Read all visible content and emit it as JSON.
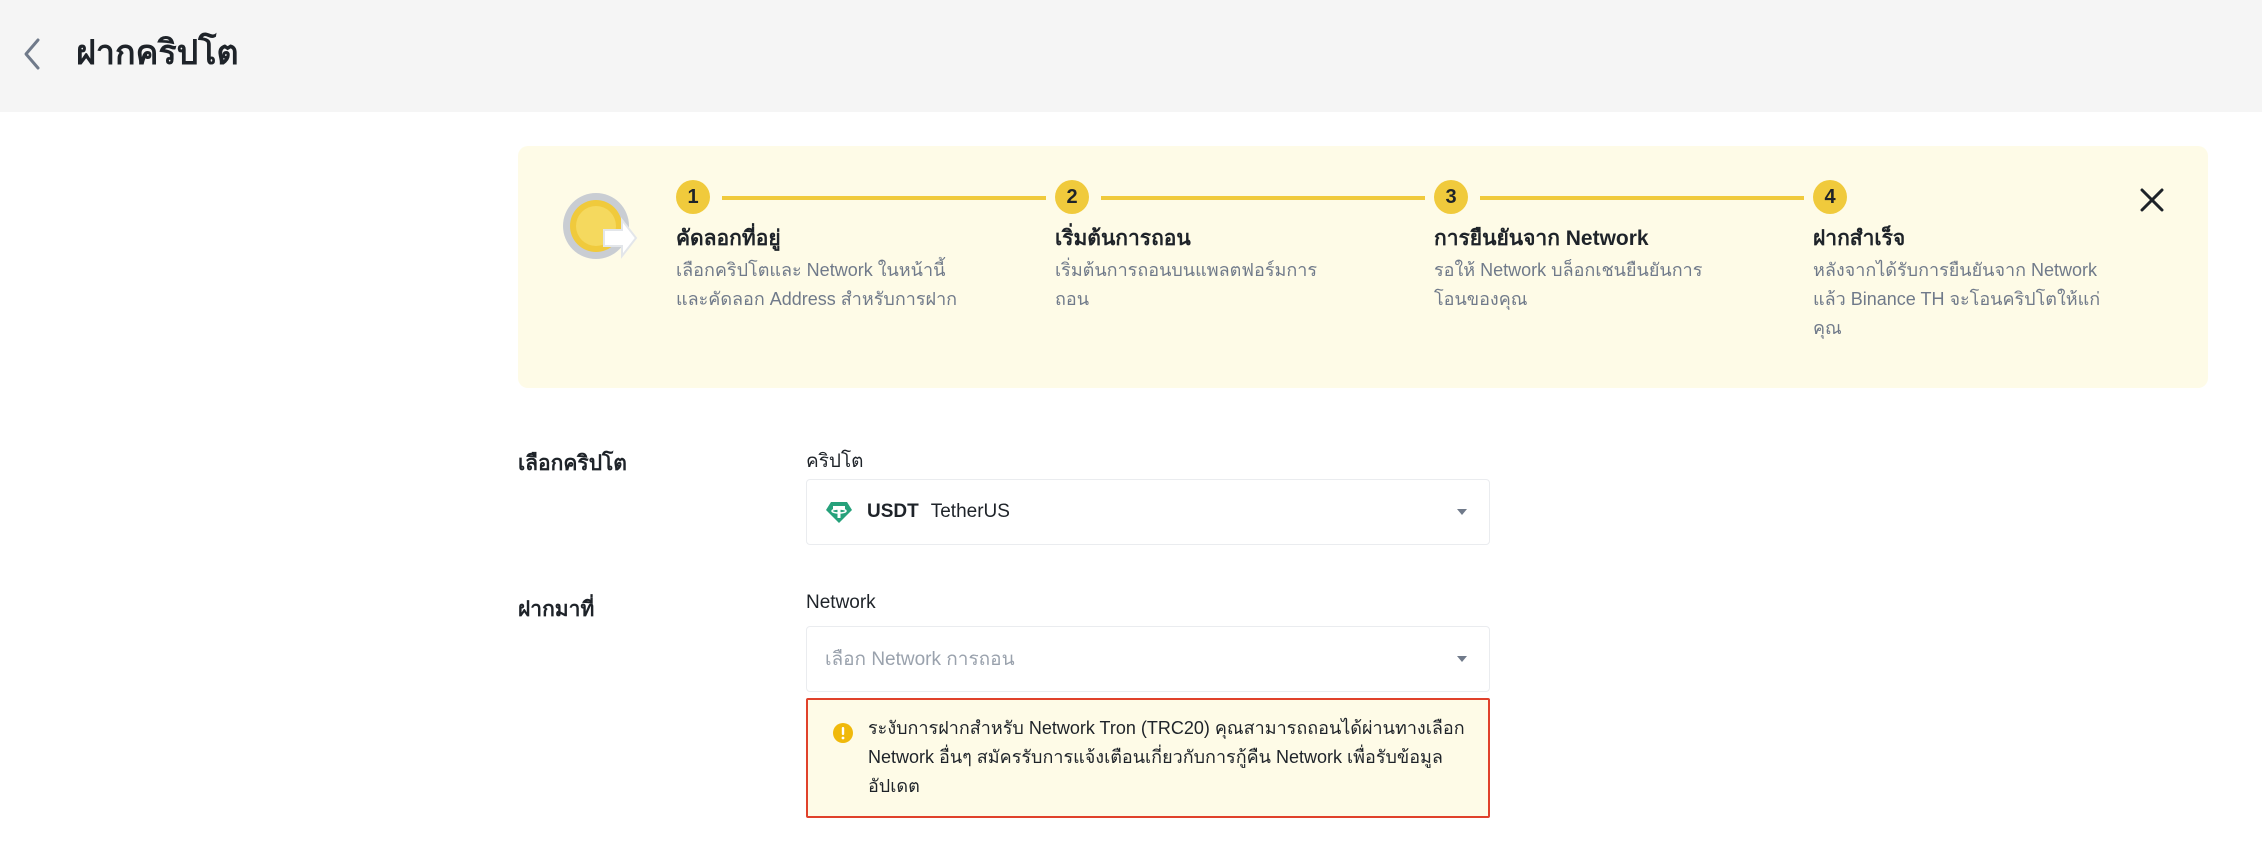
{
  "header": {
    "title": "ฝากคริปโต"
  },
  "steps": [
    {
      "number": "1",
      "title": "คัดลอกที่อยู่",
      "desc": "เลือกคริปโตและ Network ในหน้านี้และคัดลอก Address สำหรับการฝาก"
    },
    {
      "number": "2",
      "title": "เริ่มต้นการถอน",
      "desc": "เริ่มต้นการถอนบนแพลตฟอร์มการถอน"
    },
    {
      "number": "3",
      "title": "การยืนยันจาก Network",
      "desc": "รอให้ Network บล็อกเชนยืนยันการโอนของคุณ"
    },
    {
      "number": "4",
      "title": "ฝากสำเร็จ",
      "desc": "หลังจากได้รับการยืนยันจาก Network แล้ว Binance TH จะโอนคริปโตให้แก่คุณ"
    }
  ],
  "form": {
    "crypto_section_label": "เลือกคริปโต",
    "crypto_caption": "คริปโต",
    "crypto_symbol": "USDT",
    "crypto_name": "TetherUS",
    "deposit_section_label": "ฝากมาที่",
    "network_caption": "Network",
    "network_placeholder": "เลือก Network การถอน"
  },
  "warning": {
    "text": "ระงับการฝากสำหรับ Network Tron (TRC20) คุณสามารถถอนได้ผ่านทางเลือก Network อื่นๆ สมัครรับการแจ้งเตือนเกี่ยวกับการกู้คืน Network เพื่อรับข้อมูลอัปเดต"
  },
  "icons": {
    "back": "chevron-left-icon",
    "close": "close-icon",
    "coin": "tether-icon",
    "warning": "warning-icon",
    "dropdown": "caret-down-icon",
    "illustration": "deposit-coin-icon"
  },
  "colors": {
    "accent_yellow": "#f0ca3c",
    "panel_bg": "#fefbe7",
    "warning_border": "#e0412b",
    "tether_green": "#26a17b"
  }
}
